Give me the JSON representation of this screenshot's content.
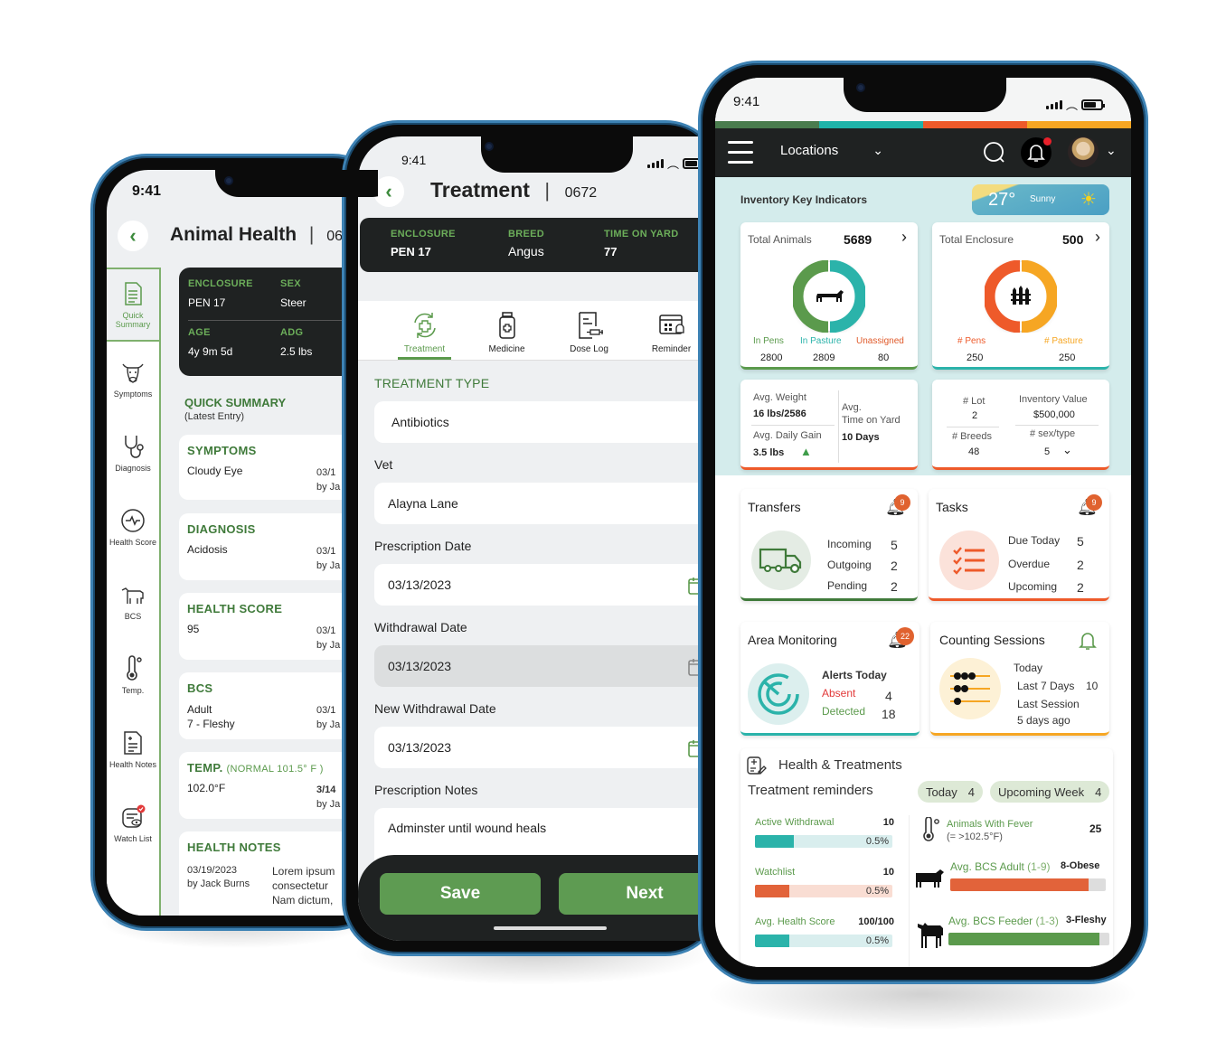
{
  "status_bar": {
    "time": "9:41"
  },
  "animal_health": {
    "title": "Animal Health",
    "id_partial": "06",
    "info": [
      {
        "label": "ENCLOSURE",
        "value": "PEN 17"
      },
      {
        "label": "SEX",
        "value": "Steer"
      },
      {
        "label": "AGE",
        "value": "4y 9m 5d"
      },
      {
        "label": "ADG",
        "value": "2.5 lbs"
      }
    ],
    "sidebar": [
      {
        "label": "Quick Summary",
        "icon": "document-list-icon",
        "active": true
      },
      {
        "label": "Symptoms",
        "icon": "cow-head-icon"
      },
      {
        "label": "Diagnosis",
        "icon": "stethoscope-icon"
      },
      {
        "label": "Health Score",
        "icon": "heartbeat-icon"
      },
      {
        "label": "BCS",
        "icon": "cow-icon"
      },
      {
        "label": "Temp.",
        "icon": "thermometer-icon"
      },
      {
        "label": "Health Notes",
        "icon": "notes-icon"
      },
      {
        "label": "Watch List",
        "icon": "watch-list-icon"
      }
    ],
    "summary_title": "QUICK SUMMARY",
    "summary_subtitle": "(Latest Entry)",
    "cards": [
      {
        "title": "SYMPTOMS",
        "value": "Cloudy Eye",
        "date": "03/1",
        "by": "by Ja"
      },
      {
        "title": "DIAGNOSIS",
        "value": "Acidosis",
        "date": "03/1",
        "by": "by Ja"
      },
      {
        "title": "HEALTH SCORE",
        "value": "95",
        "date": "03/1",
        "by": "by Ja"
      },
      {
        "title": "BCS",
        "value": "Adult",
        "value2": "7 - Fleshy",
        "date": "03/1",
        "by": "by Ja"
      },
      {
        "title": "TEMP.",
        "title_note": "(NORMAL 101.5° F )",
        "value": "102.0°F",
        "date": "3/14",
        "by": "by Ja"
      }
    ],
    "notes": {
      "title": "HEALTH NOTES",
      "date": "03/19/2023",
      "by": "by Jack Burns",
      "lines": [
        "Lorem ipsum",
        "consectetur",
        "Nam dictum,"
      ]
    }
  },
  "treatment": {
    "title": "Treatment",
    "id": "0672",
    "info": [
      {
        "label": "ENCLOSURE",
        "value": "PEN 17"
      },
      {
        "label": "BREED",
        "value": "Angus"
      },
      {
        "label": "TIME ON YARD",
        "value": "77"
      }
    ],
    "tabs": [
      {
        "label": "Treatment",
        "active": true
      },
      {
        "label": "Medicine"
      },
      {
        "label": "Dose Log"
      },
      {
        "label": "Reminder"
      }
    ],
    "section_title": "TREATMENT TYPE",
    "treatment_type": "Antibiotics",
    "vet_label": "Vet",
    "vet": "Alayna Lane",
    "prescription_date_label": "Prescription Date",
    "prescription_date": "03/13/2023",
    "withdrawal_date_label": "Withdrawal Date",
    "withdrawal_date": "03/13/2023",
    "new_withdrawal_date_label": "New Withdrawal Date",
    "new_withdrawal_date": "03/13/2023",
    "notes_label": "Prescription Notes",
    "notes": "Adminster until wound heals",
    "save_label": "Save",
    "next_label": "Next"
  },
  "dashboard": {
    "colors": {
      "green": "#4a7c4e",
      "teal": "#1fb3a9",
      "orange": "#ee5a2a",
      "yellow": "#f6a623"
    },
    "location_label": "Locations",
    "kpi_title": "Inventory Key Indicators",
    "weather": {
      "temp": "27°",
      "condition": "Sunny"
    },
    "total_animals": {
      "label": "Total Animals",
      "value": "5689",
      "segments": [
        {
          "label": "In Pens",
          "value": "2800"
        },
        {
          "label": "In Pasture",
          "value": "2809"
        },
        {
          "label": "Unassigned",
          "value": "80"
        }
      ]
    },
    "total_enclosure": {
      "label": "Total  Enclosure",
      "value": "500",
      "segments": [
        {
          "label": "# Pens",
          "value": "250"
        },
        {
          "label": "# Pasture",
          "value": "250"
        }
      ]
    },
    "weights": {
      "avg_weight_label": "Avg. Weight",
      "avg_weight": "16 lbs/2586",
      "adg_label": "Avg. Daily Gain",
      "adg": "3.5 lbs",
      "time_label_1": "Avg.",
      "time_label_2": "Time on Yard",
      "time": "10 Days"
    },
    "inventory": {
      "lot_label": "# Lot",
      "lot": "2",
      "value_label": "Inventory Value",
      "value": "$500,000",
      "breeds_label": "# Breeds",
      "breeds": "48",
      "sex_label": "# sex/type",
      "sex": "5"
    },
    "transfers": {
      "title": "Transfers",
      "badge": "9",
      "rows": [
        {
          "label": "Incoming",
          "value": "5"
        },
        {
          "label": "Outgoing",
          "value": "2"
        },
        {
          "label": "Pending",
          "value": "2"
        }
      ]
    },
    "tasks": {
      "title": "Tasks",
      "badge": "9",
      "rows": [
        {
          "label": "Due Today",
          "value": "5"
        },
        {
          "label": "Overdue",
          "value": "2"
        },
        {
          "label": "Upcoming",
          "value": "2"
        }
      ]
    },
    "area": {
      "title": "Area Monitoring",
      "badge": "22",
      "alerts_label": "Alerts Today",
      "absent_label": "Absent",
      "absent": "4",
      "detected_label": "Detected",
      "detected": "18"
    },
    "counting": {
      "title": "Counting Sessions",
      "today": "Today",
      "last7_label": "Last 7 Days",
      "last7": "10",
      "last_session_label": "Last Session",
      "last_session": "5 days ago"
    },
    "health": {
      "title": "Health & Treatments",
      "reminders_label": "Treatment reminders",
      "chips": [
        {
          "label": "Today",
          "value": "4"
        },
        {
          "label": "Upcoming Week",
          "value": "4"
        }
      ],
      "left": [
        {
          "label": "Active Withdrawal",
          "value": "10",
          "pct_label": "0.5%",
          "fill": 0.28
        },
        {
          "label": "Watchlist",
          "value": "10",
          "pct_label": "0.5%",
          "fill": 0.25
        },
        {
          "label": "Avg. Health Score",
          "value": "100/100",
          "pct_label": "0.5%",
          "fill": 0.25
        }
      ],
      "fever": {
        "label": "Animals With Fever",
        "sub": "(= >102.5°F)",
        "value": "25"
      },
      "bcs_adult": {
        "label": "Avg. BCS Adult",
        "range": "(1-9)",
        "value": "8-Obese",
        "fill": 0.89
      },
      "bcs_feeder": {
        "label": "Avg. BCS Feeder",
        "range": "(1-3)",
        "value": "3-Fleshy",
        "fill": 0.94
      }
    }
  }
}
